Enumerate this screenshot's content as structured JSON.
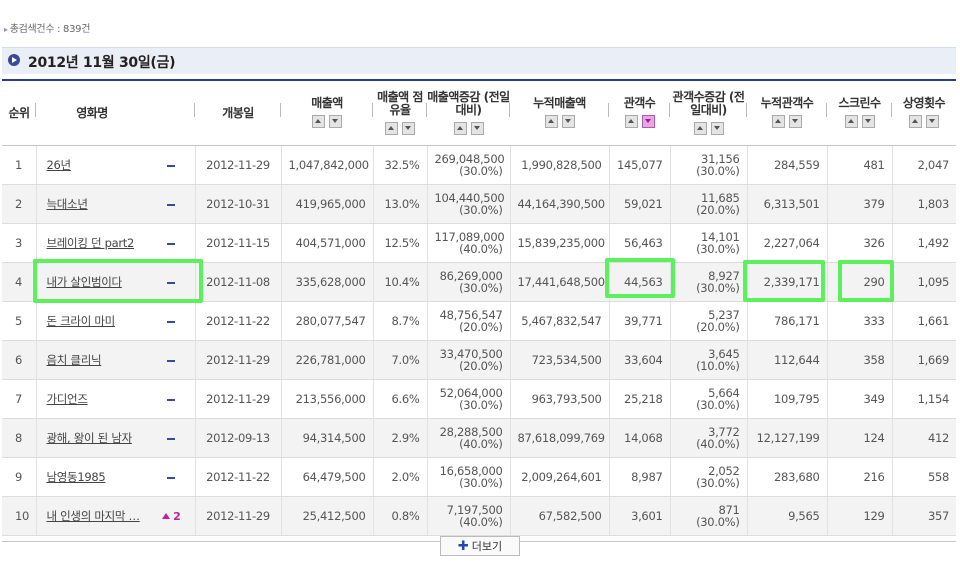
{
  "summary": {
    "result_count": "총검색건수 : 839건"
  },
  "date_header": "2012년 11월 30일(금)",
  "columns": [
    {
      "label": "순위",
      "sortable": false
    },
    {
      "label": "영화명",
      "sortable": false
    },
    {
      "label": "",
      "sortable": false
    },
    {
      "label": "개봉일",
      "sortable": false
    },
    {
      "label": "매출액",
      "sortable": true
    },
    {
      "label": "매출액 점유율",
      "sortable": true
    },
    {
      "label": "매출액증감 (전일대비)",
      "sortable": true
    },
    {
      "label": "누적매출액",
      "sortable": true
    },
    {
      "label": "관객수",
      "sortable": true,
      "active": true
    },
    {
      "label": "관객수증감 (전일대비)",
      "sortable": true
    },
    {
      "label": "누적관객수",
      "sortable": true
    },
    {
      "label": "스크린수",
      "sortable": true
    },
    {
      "label": "상영횟수",
      "sortable": true
    }
  ],
  "rows": [
    {
      "rank": "1",
      "title": "26년",
      "change": "-",
      "open_date": "2012-11-29",
      "sales": "1,047,842,000",
      "share": "32.5%",
      "sales_diff": "269,048,500",
      "sales_diff_pct": "(30.0%)",
      "cum_sales": "1,990,828,500",
      "audience": "145,077",
      "aud_diff": "31,156",
      "aud_diff_pct": "(30.0%)",
      "cum_audience": "284,559",
      "screens": "481",
      "shows": "2,047"
    },
    {
      "rank": "2",
      "title": "늑대소년",
      "change": "-",
      "open_date": "2012-10-31",
      "sales": "419,965,000",
      "share": "13.0%",
      "sales_diff": "104,440,500",
      "sales_diff_pct": "(30.0%)",
      "cum_sales": "44,164,390,500",
      "audience": "59,021",
      "aud_diff": "11,685",
      "aud_diff_pct": "(20.0%)",
      "cum_audience": "6,313,501",
      "screens": "379",
      "shows": "1,803"
    },
    {
      "rank": "3",
      "title": "브레이킹 던 part2",
      "change": "-",
      "open_date": "2012-11-15",
      "sales": "404,571,000",
      "share": "12.5%",
      "sales_diff": "117,089,000",
      "sales_diff_pct": "(40.0%)",
      "cum_sales": "15,839,235,000",
      "audience": "56,463",
      "aud_diff": "14,101",
      "aud_diff_pct": "(30.0%)",
      "cum_audience": "2,227,064",
      "screens": "326",
      "shows": "1,492"
    },
    {
      "rank": "4",
      "title": "내가 살인범이다",
      "change": "-",
      "open_date": "2012-11-08",
      "sales": "335,628,000",
      "share": "10.4%",
      "sales_diff": "86,269,000",
      "sales_diff_pct": "(30.0%)",
      "cum_sales": "17,441,648,500",
      "audience": "44,563",
      "aud_diff": "8,927",
      "aud_diff_pct": "(30.0%)",
      "cum_audience": "2,339,171",
      "screens": "290",
      "shows": "1,095"
    },
    {
      "rank": "5",
      "title": "돈 크라이 마미",
      "change": "-",
      "open_date": "2012-11-22",
      "sales": "280,077,547",
      "share": "8.7%",
      "sales_diff": "48,756,547",
      "sales_diff_pct": "(20.0%)",
      "cum_sales": "5,467,832,547",
      "audience": "39,771",
      "aud_diff": "5,237",
      "aud_diff_pct": "(20.0%)",
      "cum_audience": "786,171",
      "screens": "333",
      "shows": "1,661"
    },
    {
      "rank": "6",
      "title": "음치 클리닉",
      "change": "-",
      "open_date": "2012-11-29",
      "sales": "226,781,000",
      "share": "7.0%",
      "sales_diff": "33,470,500",
      "sales_diff_pct": "(20.0%)",
      "cum_sales": "723,534,500",
      "audience": "33,604",
      "aud_diff": "3,645",
      "aud_diff_pct": "(10.0%)",
      "cum_audience": "112,644",
      "screens": "358",
      "shows": "1,669"
    },
    {
      "rank": "7",
      "title": "가디언즈",
      "change": "-",
      "open_date": "2012-11-29",
      "sales": "213,556,000",
      "share": "6.6%",
      "sales_diff": "52,064,000",
      "sales_diff_pct": "(30.0%)",
      "cum_sales": "963,793,500",
      "audience": "25,218",
      "aud_diff": "5,664",
      "aud_diff_pct": "(30.0%)",
      "cum_audience": "109,795",
      "screens": "349",
      "shows": "1,154"
    },
    {
      "rank": "8",
      "title": "광해, 왕이 된 남자",
      "change": "-",
      "open_date": "2012-09-13",
      "sales": "94,314,500",
      "share": "2.9%",
      "sales_diff": "28,288,500",
      "sales_diff_pct": "(40.0%)",
      "cum_sales": "87,618,099,769",
      "audience": "14,068",
      "aud_diff": "3,772",
      "aud_diff_pct": "(40.0%)",
      "cum_audience": "12,127,199",
      "screens": "124",
      "shows": "412"
    },
    {
      "rank": "9",
      "title": "남영동1985",
      "change": "-",
      "open_date": "2012-11-22",
      "sales": "64,479,500",
      "share": "2.0%",
      "sales_diff": "16,658,000",
      "sales_diff_pct": "(30.0%)",
      "cum_sales": "2,009,264,601",
      "audience": "8,987",
      "aud_diff": "2,052",
      "aud_diff_pct": "(30.0%)",
      "cum_audience": "283,680",
      "screens": "216",
      "shows": "558"
    },
    {
      "rank": "10",
      "title": "내 인생의 마지막 …",
      "change": "2",
      "change_dir": "up",
      "open_date": "2012-11-29",
      "sales": "25,412,500",
      "share": "0.8%",
      "sales_diff": "7,197,500",
      "sales_diff_pct": "(40.0%)",
      "cum_sales": "67,582,500",
      "audience": "3,601",
      "aud_diff": "871",
      "aud_diff_pct": "(30.0%)",
      "cum_audience": "9,565",
      "screens": "129",
      "shows": "357"
    }
  ],
  "more_button": "더보기",
  "colors": {
    "accent": "#2c3a8a",
    "highlight": "#5cf05c",
    "rise": "#c020a0",
    "sort_active": "#e6a8e2"
  }
}
